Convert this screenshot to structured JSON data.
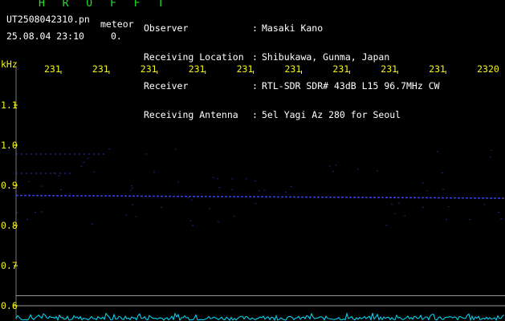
{
  "app": {
    "logo": "H R O F F T",
    "filename": "UT2508042310.pn",
    "mode_label": "meteor",
    "timestamp": "25.08.04 23:10",
    "count": "0."
  },
  "header": [
    {
      "label": "Observer",
      "colon": ":",
      "value": "Masaki Kano"
    },
    {
      "label": "Receiving Location",
      "colon": ":",
      "value": "Shibukawa, Gunma, Japan"
    },
    {
      "label": "Receiver",
      "colon": ":",
      "value": "RTL-SDR SDR# 43dB L15 96.7MHz CW"
    },
    {
      "label": "Receiving Antenna",
      "colon": ":",
      "value": "5el Yagi Az 280 for Seoul"
    }
  ],
  "chart_data": {
    "type": "heatmap",
    "title": "",
    "ylabel": "kHz",
    "xlabel": "",
    "x_ticks": [
      "231",
      "231",
      "231",
      "231",
      "231",
      "231",
      "231",
      "231",
      "231",
      "2320"
    ],
    "y_ticks": [
      "1.1",
      "1.0",
      "0.9",
      "0.8",
      "0.7",
      "0.6"
    ],
    "ylim": [
      0.58,
      1.18
    ],
    "signal": {
      "name": "",
      "freq_khz_start": 0.875,
      "freq_khz_end": 0.868
    },
    "echo_lines_khz": [
      0.978,
      0.93
    ],
    "reference_lines_khz": [
      0.625,
      0.6
    ],
    "colors": {
      "background": "#000000",
      "signal": "#3a46ff",
      "reference": "#c8c8c8",
      "ticks": "#f5f518",
      "noise": "#00e0ff"
    }
  }
}
